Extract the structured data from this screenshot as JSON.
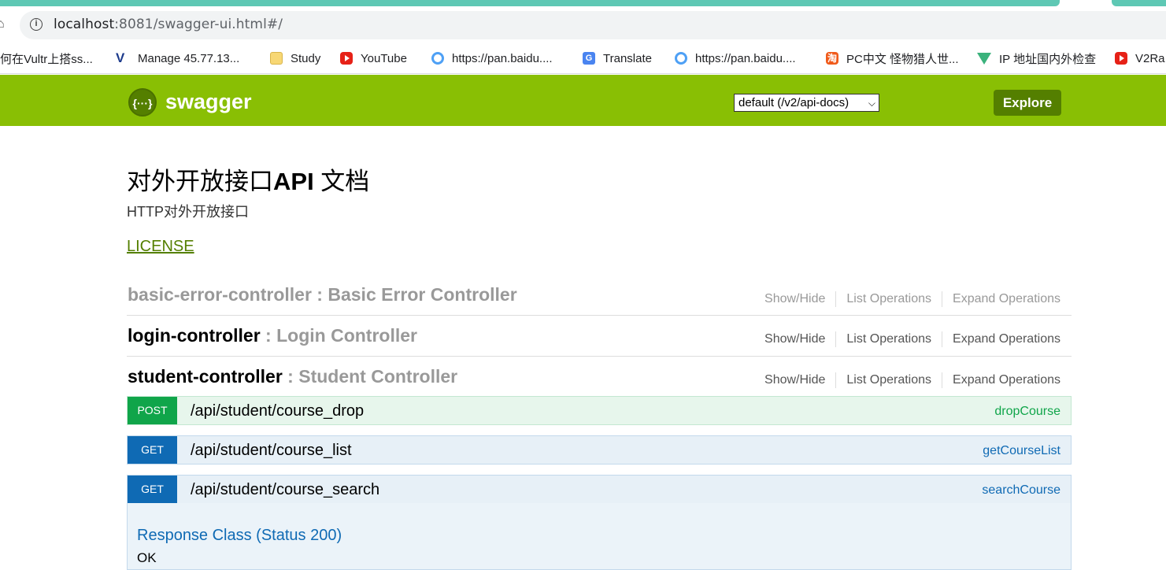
{
  "browser": {
    "url_host": "localhost",
    "url_rest": ":8081/swagger-ui.html#/",
    "bookmarks": [
      {
        "label": "何在Vultr上搭ss...",
        "icon": "none"
      },
      {
        "label": "Manage 45.77.13...",
        "icon": "vultr-icon"
      },
      {
        "label": "Study",
        "icon": "folder-icon"
      },
      {
        "label": "YouTube",
        "icon": "youtube-icon"
      },
      {
        "label": "https://pan.baidu....",
        "icon": "baidu-pan-icon"
      },
      {
        "label": "Translate",
        "icon": "google-translate-icon"
      },
      {
        "label": "https://pan.baidu....",
        "icon": "baidu-pan-icon"
      },
      {
        "label": "PC中文 怪物猎人世...",
        "icon": "taobao-icon"
      },
      {
        "label": "IP 地址国内外检查",
        "icon": "vue-icon"
      },
      {
        "label": "V2Ra",
        "icon": "youtube-icon"
      }
    ]
  },
  "header": {
    "logo_glyph": "{···}",
    "title": "swagger",
    "api_select_value": "default (/v2/api-docs)",
    "explore_label": "Explore"
  },
  "info": {
    "title_pre": "对外开放接口",
    "title_bold": "API",
    "title_post": " 文档",
    "description": "HTTP对外开放接口",
    "license": "LICENSE"
  },
  "resources": [
    {
      "name": "basic-error-controller",
      "sep": " : ",
      "desc": "Basic Error Controller",
      "show_hide": "Show/Hide",
      "list_ops": "List Operations",
      "expand_ops": "Expand Operations"
    },
    {
      "name": "login-controller",
      "sep": " : ",
      "desc": "Login Controller",
      "show_hide": "Show/Hide",
      "list_ops": "List Operations",
      "expand_ops": "Expand Operations"
    },
    {
      "name": "student-controller",
      "sep": " : ",
      "desc": "Student Controller",
      "show_hide": "Show/Hide",
      "list_ops": "List Operations",
      "expand_ops": "Expand Operations"
    }
  ],
  "operations": [
    {
      "method": "POST",
      "path": "/api/student/course_drop",
      "nickname": "dropCourse"
    },
    {
      "method": "GET",
      "path": "/api/student/course_list",
      "nickname": "getCourseList"
    },
    {
      "method": "GET",
      "path": "/api/student/course_search",
      "nickname": "searchCourse"
    }
  ],
  "expanded": {
    "response_class": "Response Class (Status 200)",
    "response_value": "OK"
  },
  "colors": {
    "swagger_green": "#89bf04",
    "dark_green": "#547f00",
    "post_green": "#10a54a",
    "get_blue": "#0f6ab4",
    "tab_teal": "#5ec8b4"
  }
}
